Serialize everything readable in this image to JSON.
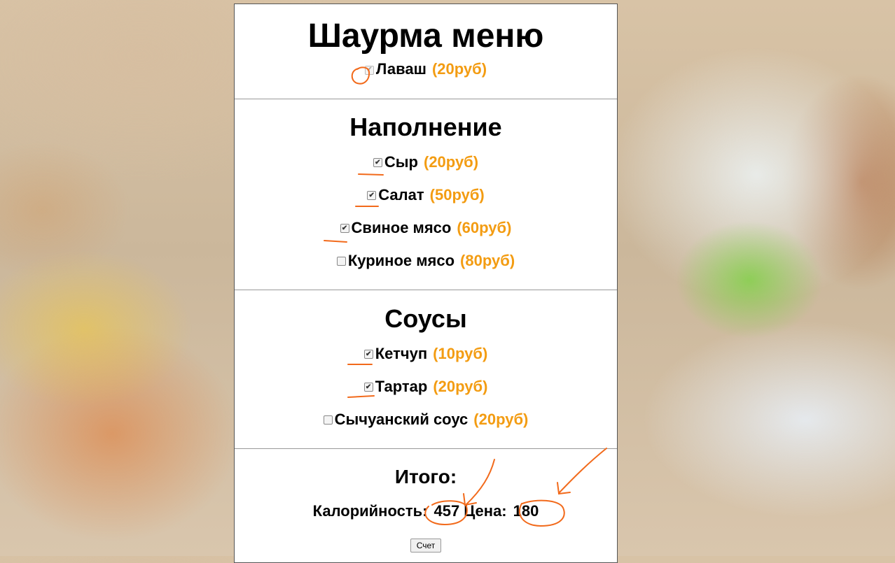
{
  "title": "Шаурма меню",
  "base": {
    "label": "Лаваш",
    "price": "(20руб)",
    "checked": true,
    "disabled": true
  },
  "fillings": {
    "heading": "Наполнение",
    "items": [
      {
        "label": "Сыр",
        "price": "(20руб)",
        "checked": true
      },
      {
        "label": "Салат",
        "price": "(50руб)",
        "checked": true
      },
      {
        "label": "Свиное мясо",
        "price": "(60руб)",
        "checked": true
      },
      {
        "label": "Куриное мясо",
        "price": "(80руб)",
        "checked": false
      }
    ]
  },
  "sauces": {
    "heading": "Соусы",
    "items": [
      {
        "label": "Кетчуп",
        "price": "(10руб)",
        "checked": true
      },
      {
        "label": "Тартар",
        "price": "(20руб)",
        "checked": true
      },
      {
        "label": "Сычуанский соус",
        "price": "(20руб)",
        "checked": false
      }
    ]
  },
  "summary": {
    "heading": "Итого:",
    "calories_label": "Калорийность:",
    "calories_value": "457",
    "price_label": "Цена:",
    "price_value": "180",
    "button_label": "Счет"
  },
  "colors": {
    "price": "#f39c12",
    "annotation": "#f26a1b"
  }
}
